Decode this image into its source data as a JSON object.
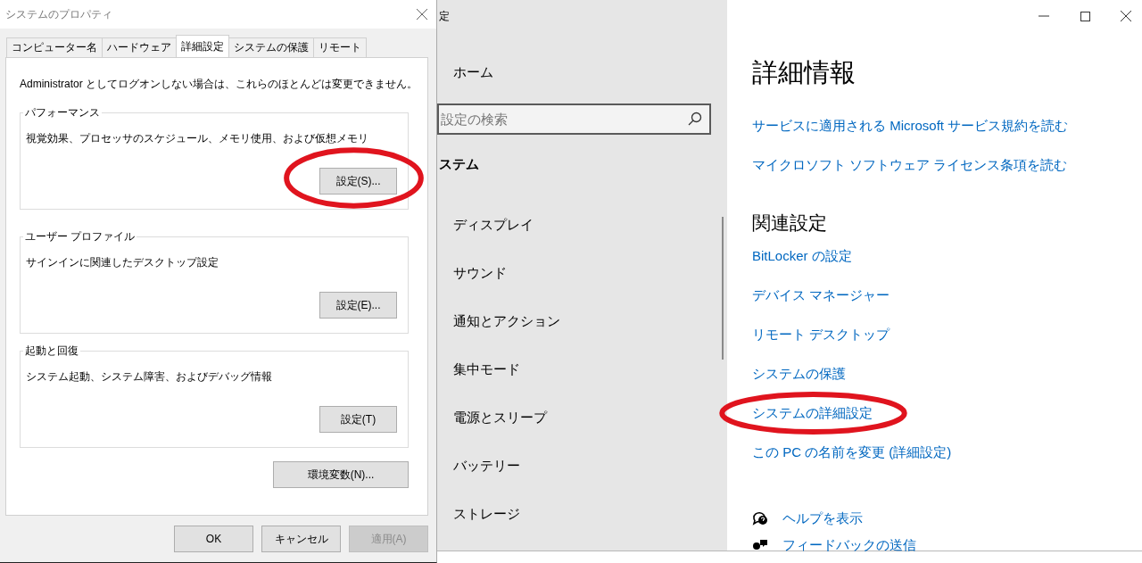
{
  "dialog": {
    "title": "システムのプロパティ",
    "tabs": [
      {
        "label": "コンピューター名",
        "selected": false
      },
      {
        "label": "ハードウェア",
        "selected": false
      },
      {
        "label": "詳細設定",
        "selected": true
      },
      {
        "label": "システムの保護",
        "selected": false
      },
      {
        "label": "リモート",
        "selected": false
      }
    ],
    "notice": "Administrator としてログオンしない場合は、これらのほとんどは変更できません。",
    "groups": [
      {
        "title": "パフォーマンス",
        "description": "視覚効果、プロセッサのスケジュール、メモリ使用、および仮想メモリ",
        "button": {
          "label": "設定(S)...",
          "highlight": true
        }
      },
      {
        "title": "ユーザー プロファイル",
        "description": "サインインに関連したデスクトップ設定",
        "button": {
          "label": "設定(E)...",
          "highlight": false
        }
      },
      {
        "title": "起動と回復",
        "description": "システム起動、システム障害、およびデバッグ情報",
        "button": {
          "label": "設定(T)",
          "highlight": false
        }
      }
    ],
    "env_button": "環境変数(N)...",
    "buttons": [
      {
        "label": "OK",
        "disabled": false
      },
      {
        "label": "キャンセル",
        "disabled": false
      },
      {
        "label": "適用(A)",
        "disabled": true
      }
    ]
  },
  "settings": {
    "title": "定",
    "nav": {
      "home": "ホーム",
      "search_placeholder": "設定の検索",
      "section": "ステム",
      "items": [
        "ディスプレイ",
        "サウンド",
        "通知とアクション",
        "集中モード",
        "電源とスリープ",
        "バッテリー",
        "ストレージ"
      ]
    },
    "content": {
      "title": "詳細情報",
      "links": [
        "サービスに適用される Microsoft サービス規約を読む",
        "マイクロソフト ソフトウェア ライセンス条項を読む"
      ],
      "related_title": "関連設定",
      "related_links": [
        {
          "label": "BitLocker の設定",
          "highlight": false
        },
        {
          "label": "デバイス マネージャー",
          "highlight": false
        },
        {
          "label": "リモート デスクトップ",
          "highlight": false
        },
        {
          "label": "システムの保護",
          "highlight": false
        },
        {
          "label": "システムの詳細設定",
          "highlight": true
        },
        {
          "label": "この PC の名前を変更 (詳細設定)",
          "highlight": false
        }
      ],
      "help_links": [
        {
          "kind": "help",
          "label": "ヘルプを表示"
        },
        {
          "kind": "feedback",
          "label": "フィードバックの送信"
        }
      ]
    }
  }
}
